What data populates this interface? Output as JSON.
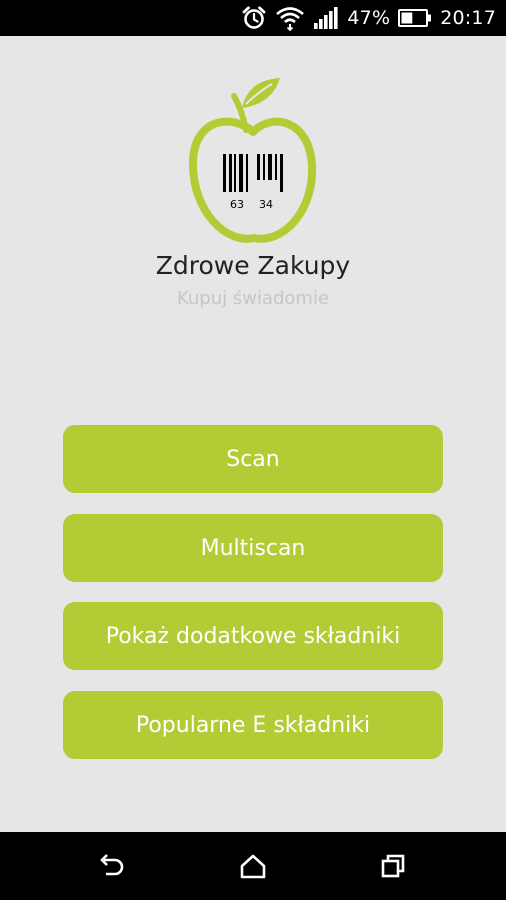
{
  "status_bar": {
    "battery_percent": "47%",
    "time": "20:17",
    "icons": [
      "alarm-icon",
      "wifi-icon",
      "cell-signal-icon",
      "battery-icon"
    ],
    "battery_level": 0.47
  },
  "app": {
    "title": "Zdrowe Zakupy",
    "subtitle": "Kupuj świadomie",
    "logo": {
      "icon": "apple-barcode-logo",
      "barcode_numbers": [
        "63",
        "34"
      ]
    }
  },
  "menu": {
    "buttons": [
      {
        "label": "Scan"
      },
      {
        "label": "Multiscan"
      },
      {
        "label": "Pokaż dodatkowe składniki"
      },
      {
        "label": "Popularne E składniki"
      }
    ]
  },
  "nav_bar": {
    "icons": [
      "back-icon",
      "home-icon",
      "recent-apps-icon"
    ]
  },
  "colors": {
    "accent": "#b2cc35",
    "background": "#e6e6e6",
    "bars": "#000000",
    "title": "#222222",
    "subtitle": "#c6c6c6"
  }
}
